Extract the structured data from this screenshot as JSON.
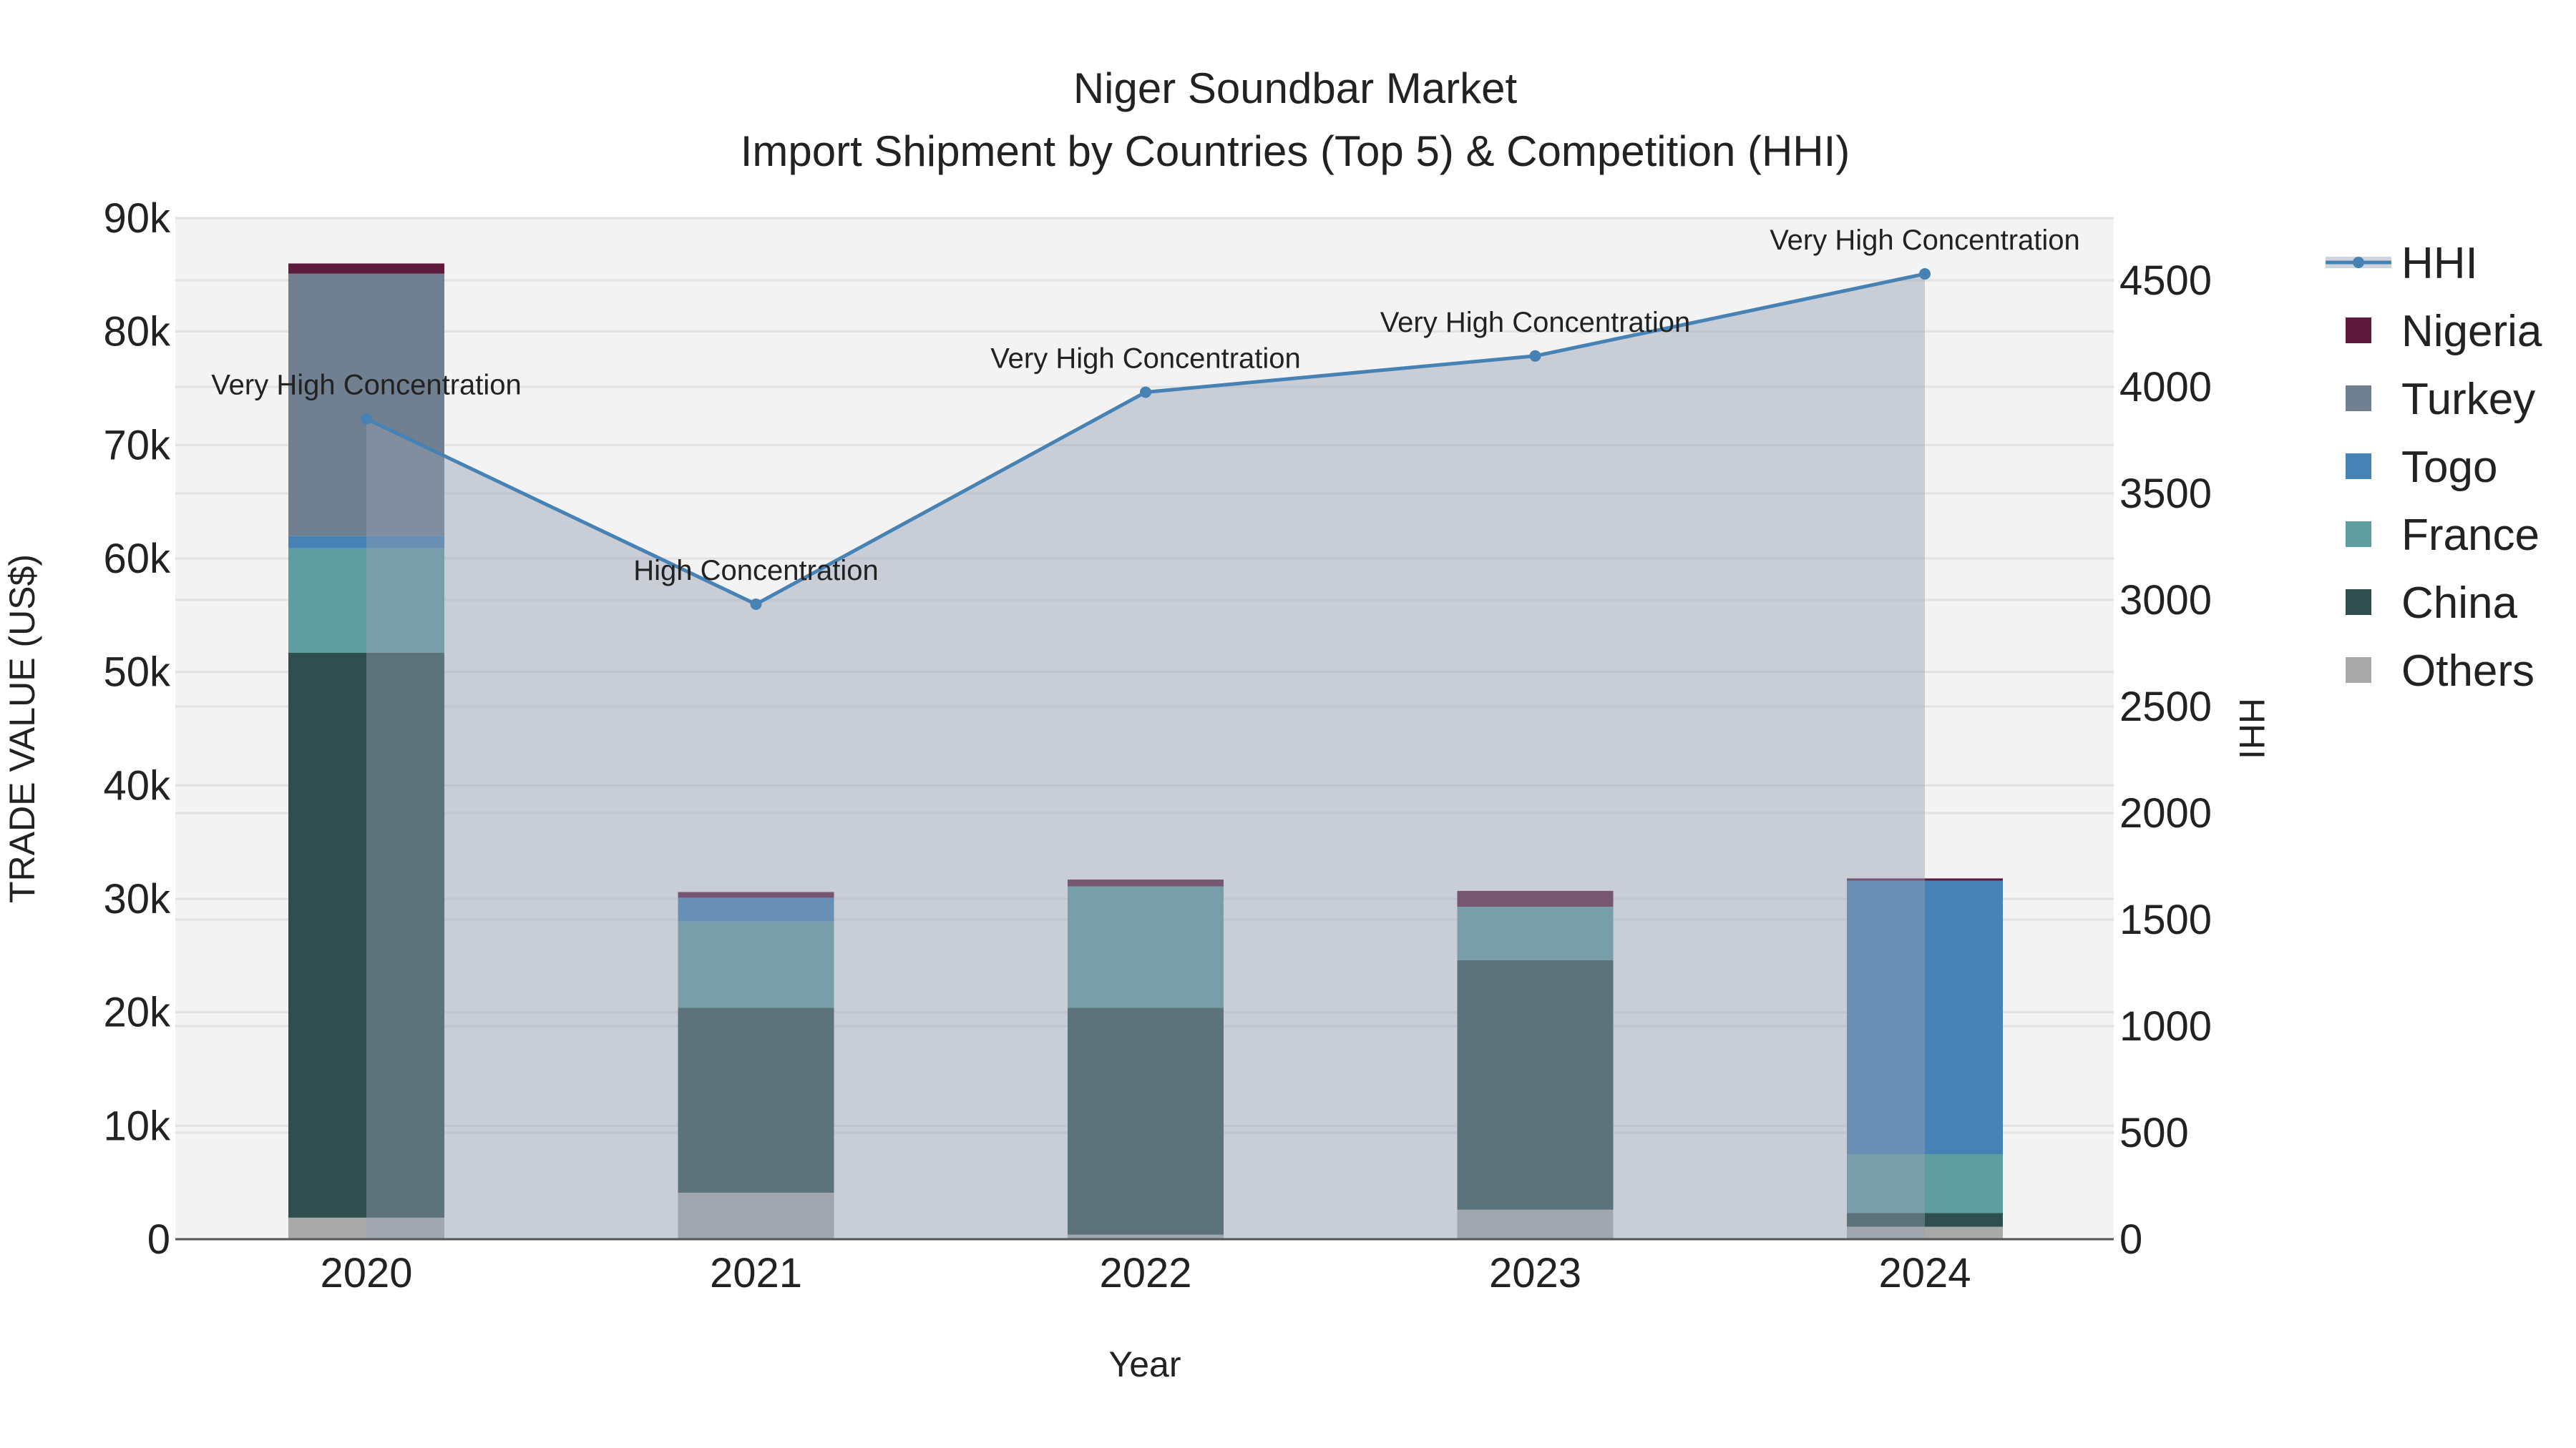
{
  "chart_data": {
    "type": "bar",
    "stacked": true,
    "title": "Niger Soundbar Market",
    "subtitle": "Import Shipment by Countries (Top 5) & Competition (HHI)",
    "xlabel": "Year",
    "ylabel": "TRADE VALUE (US$)",
    "y2label": "HHI",
    "categories": [
      "2020",
      "2021",
      "2022",
      "2023",
      "2024"
    ],
    "ylim": [
      0,
      90000
    ],
    "y2lim": [
      0,
      4800
    ],
    "yticks": [
      0,
      10000,
      20000,
      30000,
      40000,
      50000,
      60000,
      70000,
      80000,
      90000
    ],
    "ytick_labels": [
      "0",
      "10k",
      "20k",
      "30k",
      "40k",
      "50k",
      "60k",
      "70k",
      "80k",
      "90k"
    ],
    "y2ticks": [
      0,
      500,
      1000,
      1500,
      2000,
      2500,
      3000,
      3500,
      4000,
      4500
    ],
    "y2tick_labels": [
      "0",
      "500",
      "1000",
      "1500",
      "2000",
      "2500",
      "3000",
      "3500",
      "4000",
      "4500"
    ],
    "grid": true,
    "legend_position": "right",
    "series": [
      {
        "name": "Others",
        "color": "#a9a9a9",
        "values": [
          1900,
          4100,
          400,
          2600,
          1100
        ]
      },
      {
        "name": "China",
        "color": "#2f4f4f",
        "values": [
          49800,
          16300,
          20000,
          22000,
          1200
        ]
      },
      {
        "name": "France",
        "color": "#5f9ea0",
        "values": [
          9200,
          7600,
          10700,
          4700,
          5200
        ]
      },
      {
        "name": "Togo",
        "color": "#4682b4",
        "values": [
          1100,
          2100,
          0,
          0,
          24100
        ]
      },
      {
        "name": "Turkey",
        "color": "#708090",
        "values": [
          23100,
          0,
          0,
          0,
          0
        ]
      },
      {
        "name": "Nigeria",
        "color": "#5e1a3c",
        "values": [
          900,
          500,
          600,
          1400,
          200
        ]
      }
    ],
    "hhi": {
      "name": "HHI",
      "color": "#4682b4",
      "values": [
        3850,
        2980,
        3975,
        4145,
        4530
      ],
      "annotations": [
        "Very High Concentration",
        "High Concentration",
        "Very High Concentration",
        "Very High Concentration",
        "Very High Concentration"
      ]
    },
    "legend_order": [
      "HHI",
      "Nigeria",
      "Turkey",
      "Togo",
      "France",
      "China",
      "Others"
    ]
  }
}
